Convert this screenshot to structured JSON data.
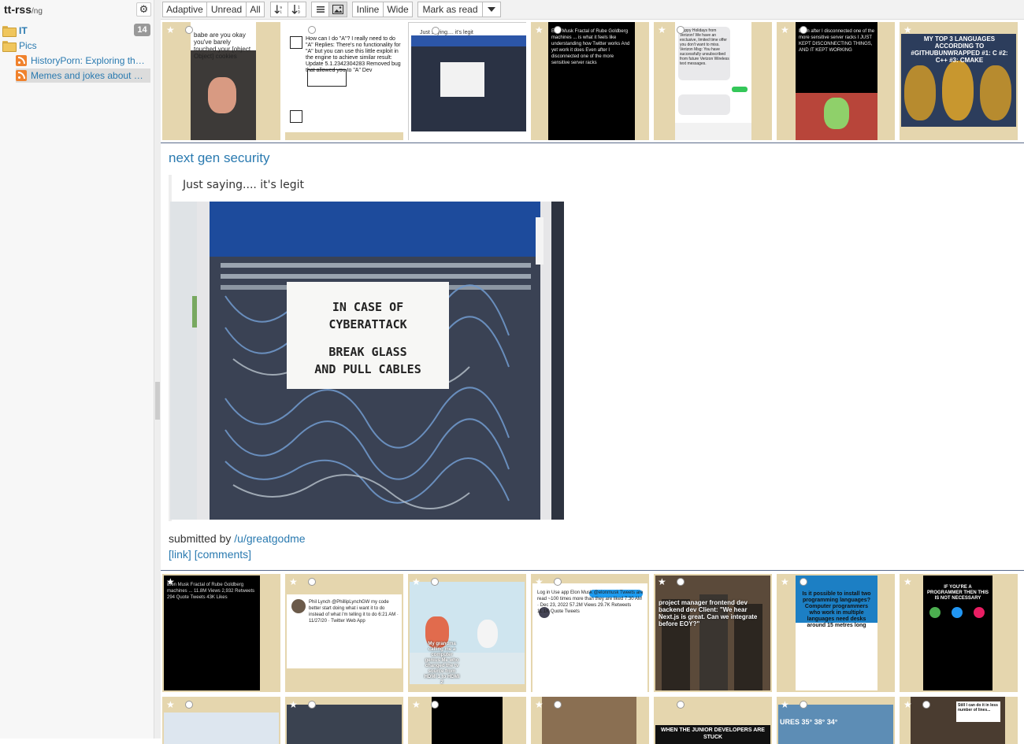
{
  "app": {
    "name": "tt-rss",
    "suffix": "/ng"
  },
  "sidebar": {
    "categories": [
      {
        "label": "IT",
        "count": "14"
      },
      {
        "label": "Pics"
      }
    ],
    "feeds": [
      {
        "label": "HistoryPorn: Exploring the Past"
      },
      {
        "label": "Memes and jokes about programming"
      }
    ]
  },
  "toolbar": {
    "view_modes": [
      "Adaptive",
      "Unread",
      "All"
    ],
    "display_modes": [
      "Inline",
      "Wide"
    ],
    "mark_as_read": "Mark as read"
  },
  "thumbs_top": [
    {
      "caption": "babe are you okay you've barely touched your [object Object] cookies"
    },
    {
      "caption": "How can I do \"A\"? I really need to do \"A\"   Replies: There's no functionality for \"A\" but you can use this little exploit in the engine to achieve similar result:   Update 5.1.2342304283 Removed bug that allowed you to \"A\"   Dev"
    },
    {
      "caption": "Just saying.... it's legit"
    },
    {
      "caption": "Elon Musk  Fractal of Rube Goldberg machines ... is what it feels like understanding how Twitter works   And yet work it does   Even after I disconnected one of the more sensitive server racks"
    },
    {
      "caption": "Happy Holidays from Verizon! We have an exclusive, limited time offer you don't want to miss.   Verizon Msg: You have successfully unsubscribed from future Verizon Wireless text messages."
    },
    {
      "caption": "Even after I disconnected one of the more sensitive server racks   I JUST KEPT DISCONNECTING THINGS, AND IT KEPT WORKING"
    },
    {
      "caption": "MY TOP 3 LANGUAGES ACCORDING TO #GITHUBUNWRAPPED   #1: C   #2: C++   #3: CMAKE"
    }
  ],
  "article": {
    "title": "next gen security",
    "quote": "Just saying.... it's legit",
    "sign_lines": [
      "IN CASE OF",
      "CYBERATTACK",
      "BREAK GLASS",
      "AND PULL CABLES"
    ],
    "submitted_prefix": "submitted by ",
    "author": "/u/greatgodme",
    "link_label": "[link]",
    "comments_label": "[comments]"
  },
  "thumbs_bottom": [
    {
      "caption": "Elon Musk  Fractal of Rube Goldberg machines ...   11.8M Views  2,932 Retweets  294 Quote Tweets  43K Likes"
    },
    {
      "caption": "Phil Lynch @PhillipLynchGW   my code better start doing what i want it to do instead of what i'm telling it to do   6:21 AM · 11/27/20 · Twitter Web App"
    },
    {
      "caption": "My grandma calling me a computer genius   Me who changed the tv source from HDMI 1 to HDMI 2"
    },
    {
      "caption": "Log in  Use app  Elon Musk @elonmusk  Tweets are read ~100 times more than they are liked  7:30 AM · Dec 23, 2022   57.2M Views  29.7K Retweets  11.1K Quote Tweets"
    },
    {
      "caption": "project manager   frontend dev   backend dev   Client: \"We hear Next.js is great. Can we integrate before EOY?\""
    },
    {
      "caption": "Is it possible to install two programming languages?   Computer programmers who work in multiple languages need desks around 15 metres long"
    },
    {
      "caption": "IF YOU'RE A PROGRAMMER THEN THIS IS NOT NECESSARY"
    }
  ],
  "thumbs_row3": [
    {
      "caption": ""
    },
    {
      "caption": ""
    },
    {
      "caption": ""
    },
    {
      "caption": ""
    },
    {
      "caption": "WHEN THE JUNIOR DEVELOPERS ARE STUCK"
    },
    {
      "caption": "URES  35°  38°  34°"
    },
    {
      "caption": "Still I can do it in less number of lines..."
    }
  ],
  "colors": {
    "link": "#2a7ab0",
    "thumb_bg": "#e5d6ae",
    "rss": "#f0822d"
  }
}
